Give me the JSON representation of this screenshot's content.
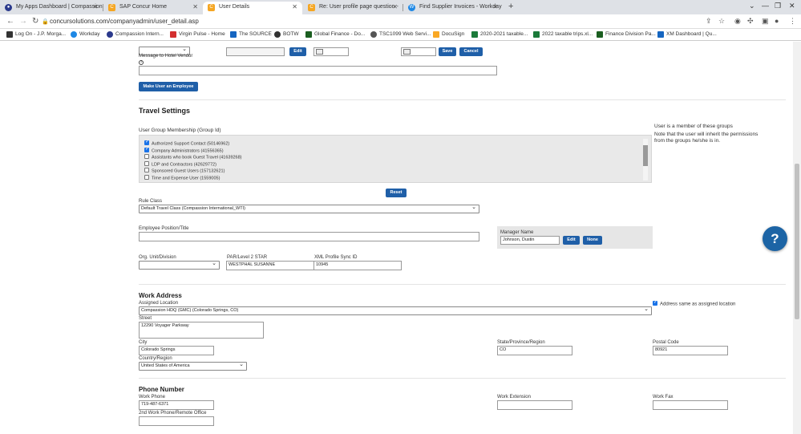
{
  "browser": {
    "tabs": [
      {
        "title": "My Apps Dashboard | Compassion",
        "icon_color": "#2b3a8c",
        "icon": "app-icon"
      },
      {
        "title": "SAP Concur Home",
        "icon_color": "#f5a623",
        "icon": "concur-icon"
      },
      {
        "title": "User Details",
        "icon_color": "#f5a623",
        "icon": "concur-icon"
      },
      {
        "title": "Re: User profile page question -",
        "icon_color": "#f5a623",
        "icon": "concur-icon"
      },
      {
        "title": "Find Supplier Invoices - Workday",
        "icon_color": "#1e88e5",
        "icon": "workday-icon"
      }
    ],
    "url": "concursolutions.com/companyadmin/user_detail.asp",
    "bookmarks": [
      {
        "label": "Log On - J.P. Morga...",
        "color": "#333"
      },
      {
        "label": "Workday",
        "color": "#1e88e5"
      },
      {
        "label": "Compassion Intern...",
        "color": "#2b3a8c"
      },
      {
        "label": "Virgin Pulse - Home",
        "color": "#d32f2f"
      },
      {
        "label": "The SOURCE",
        "color": "#1565c0"
      },
      {
        "label": "BOTW",
        "color": "#333"
      },
      {
        "label": "Global Finance - Do...",
        "color": "#1b5e20"
      },
      {
        "label": "TSC1099 Web Servi...",
        "color": "#555"
      },
      {
        "label": "DocuSign",
        "color": "#f9a825"
      },
      {
        "label": "2020-2021 taxable...",
        "color": "#1b7a3a"
      },
      {
        "label": "2022 taxable trips.xl...",
        "color": "#1b7a3a"
      },
      {
        "label": "Finance Division Pa...",
        "color": "#1b5e20"
      },
      {
        "label": "XM Dashboard | Qu...",
        "color": "#1565c0"
      }
    ]
  },
  "top": {
    "edit_label": "Edit",
    "save_label": "Save",
    "cancel_label": "Cancel",
    "hotel_message_label": "Message to Hotel Vendor",
    "make_employee_label": "Make User an Employee"
  },
  "travel": {
    "heading": "Travel Settings",
    "group_membership_label": "User Group Membership (Group Id)",
    "groups": [
      {
        "label": "Authorized Support Contact (50146962)",
        "checked": true
      },
      {
        "label": "Company Administrators (41556365)",
        "checked": true
      },
      {
        "label": "Assistants who book Guest Travel (41639268)",
        "checked": false
      },
      {
        "label": "LDP and Contractors (42629772)",
        "checked": false
      },
      {
        "label": "Sponsored Guest Users (157132621)",
        "checked": false
      },
      {
        "label": "Time and Expense User (1559005)",
        "checked": false
      }
    ],
    "group_note_1": "User is a member of these groups",
    "group_note_2": "Note that the user will inherit the permissions",
    "group_note_3": "from the groups he/she is in.",
    "reset_label": "Reset",
    "rule_class_label": "Rule Class",
    "rule_class_value": "Default Travel Class (Compassion International_WTI)",
    "position_label": "Employee Position/Title",
    "manager_label": "Manager Name",
    "manager_value": "Johnson, Dustin",
    "manager_edit_label": "Edit",
    "manager_none_label": "None",
    "org_unit_label": "Org. Unit/Division",
    "par_label": "PAR/Level 2 STAR",
    "par_value": "WESTPHAL SUSANNE",
    "xml_label": "XML Profile Sync ID",
    "xml_value": "10945"
  },
  "work_address": {
    "heading": "Work Address",
    "assigned_location_label": "Assigned Location",
    "assigned_location_value": "Compassion HDQ (GMC) (Colorado Springs, CO)",
    "same_as_label": "Address same as assigned location",
    "street_label": "Street",
    "street_value": "12290 Voyager Parkway",
    "city_label": "City",
    "city_value": "Colorado Springs",
    "state_label": "State/Province/Region",
    "state_value": "CO",
    "postal_label": "Postal Code",
    "postal_value": "80921",
    "country_label": "Country/Region",
    "country_value": "United States of America"
  },
  "phone": {
    "heading": "Phone Number",
    "work_phone_label": "Work Phone",
    "work_phone_value": "719-487-6371",
    "work_ext_label": "Work Extension",
    "work_fax_label": "Work Fax",
    "second_phone_label": "2nd Work Phone/Remote Office"
  },
  "help_label": "?"
}
